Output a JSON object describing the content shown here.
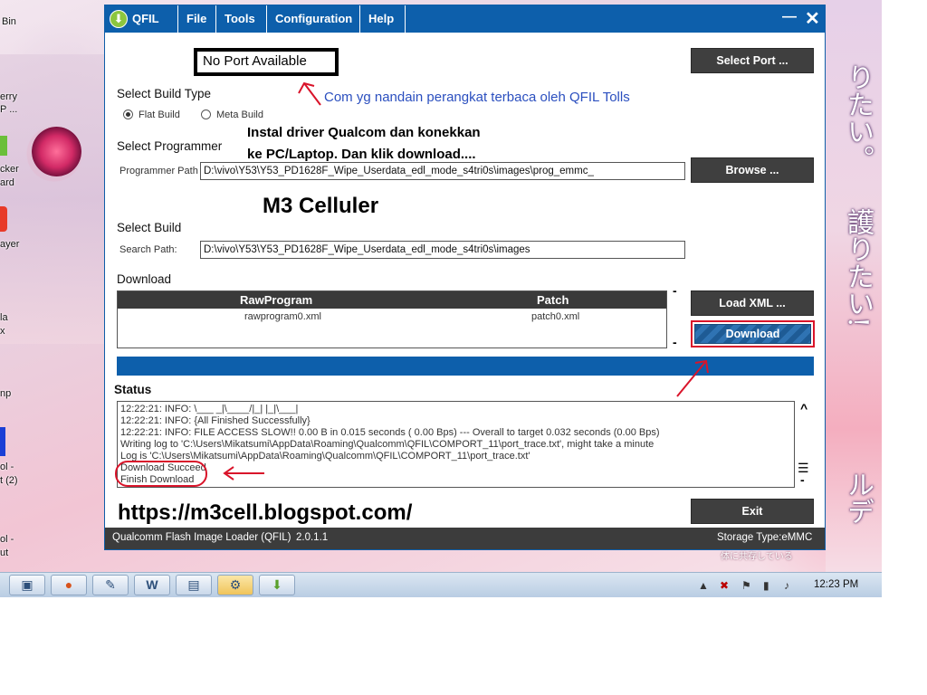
{
  "desktop": {
    "icon_labels": [
      "Bin",
      "erry",
      "P ...",
      "cker",
      "ard",
      "ayer",
      "la",
      "x",
      "np",
      "ol -",
      "t (2)",
      "ol -",
      "ut"
    ],
    "wallpaper_text": [
      "り",
      "た",
      "い",
      "。",
      "護",
      "り",
      "た",
      "い",
      "!",
      "ル",
      "デ"
    ],
    "wallpaper_caption": "体に共存している"
  },
  "window": {
    "app_name": "QFIL",
    "menu": [
      "File",
      "Tools",
      "Configuration",
      "Help"
    ],
    "minimize_glyph": "—",
    "close_glyph": "✕",
    "port_status": "No Port Available",
    "select_port_label": "Select Port ...",
    "select_build_type": {
      "heading": "Select Build Type",
      "options": [
        {
          "label": "Flat Build",
          "selected": true
        },
        {
          "label": "Meta Build",
          "selected": false
        }
      ]
    },
    "select_programmer": {
      "heading": "Select Programmer",
      "path_label": "Programmer Path",
      "path_value": "D:\\vivo\\Y53\\Y53_PD1628F_Wipe_Userdata_edl_mode_s4tri0s\\images\\prog_emmc_",
      "browse_label": "Browse ..."
    },
    "select_build": {
      "heading": "Select Build",
      "path_label": "Search Path:",
      "path_value": "D:\\vivo\\Y53\\Y53_PD1628F_Wipe_Userdata_edl_mode_s4tri0s\\images"
    },
    "download": {
      "heading": "Download",
      "columns": [
        "RawProgram",
        "Patch"
      ],
      "rows": [
        [
          "rawprogram0.xml",
          "patch0.xml"
        ]
      ],
      "load_xml_label": "Load XML ...",
      "download_label": "Download",
      "side_marks": [
        "-",
        "-"
      ]
    },
    "status": {
      "heading": "Status",
      "log": [
        "12:22:21: INFO: \\___ _|\\____/|_| |_|\\___|",
        "12:22:21: INFO: {All Finished Successfully}",
        "12:22:21: INFO: FILE ACCESS SLOW!!     0.00 B in  0.015 seconds (     0.00 Bps) --- Overall to target  0.032 seconds (0.00 Bps)",
        "Writing log to 'C:\\Users\\Mikatsumi\\AppData\\Roaming\\Qualcomm\\QFIL\\COMPORT_11\\port_trace.txt', might take a minute",
        "Log is 'C:\\Users\\Mikatsumi\\AppData\\Roaming\\Qualcomm\\QFIL\\COMPORT_11\\port_trace.txt'",
        "Download Succeed",
        "Finish Download"
      ],
      "scroll_up_glyph": "^",
      "scroll_menu_glyph": "☰",
      "scroll_down_glyph": "-"
    },
    "exit_label": "Exit",
    "footer": {
      "app_title": "Qualcomm Flash Image Loader (QFIL)",
      "version": "2.0.1.1",
      "storage_type": "Storage Type:eMMC"
    }
  },
  "annotations": {
    "port_note": "Com yg nandain perangkat terbaca oleh QFIL Tolls",
    "instruction_line1": "Instal driver Qualcom dan konekkan",
    "instruction_line2": "ke PC/Laptop. Dan klik download....",
    "brand": "M3 Celluler",
    "blog_url": "https://m3cell.blogspot.com/"
  },
  "taskbar": {
    "clock": "12:23 PM"
  },
  "colors": {
    "title_blue": "#0d5fab",
    "button_dark": "#3f3f3f",
    "annotation_red": "#d9142a",
    "annotation_blue": "#2b4fbf"
  }
}
